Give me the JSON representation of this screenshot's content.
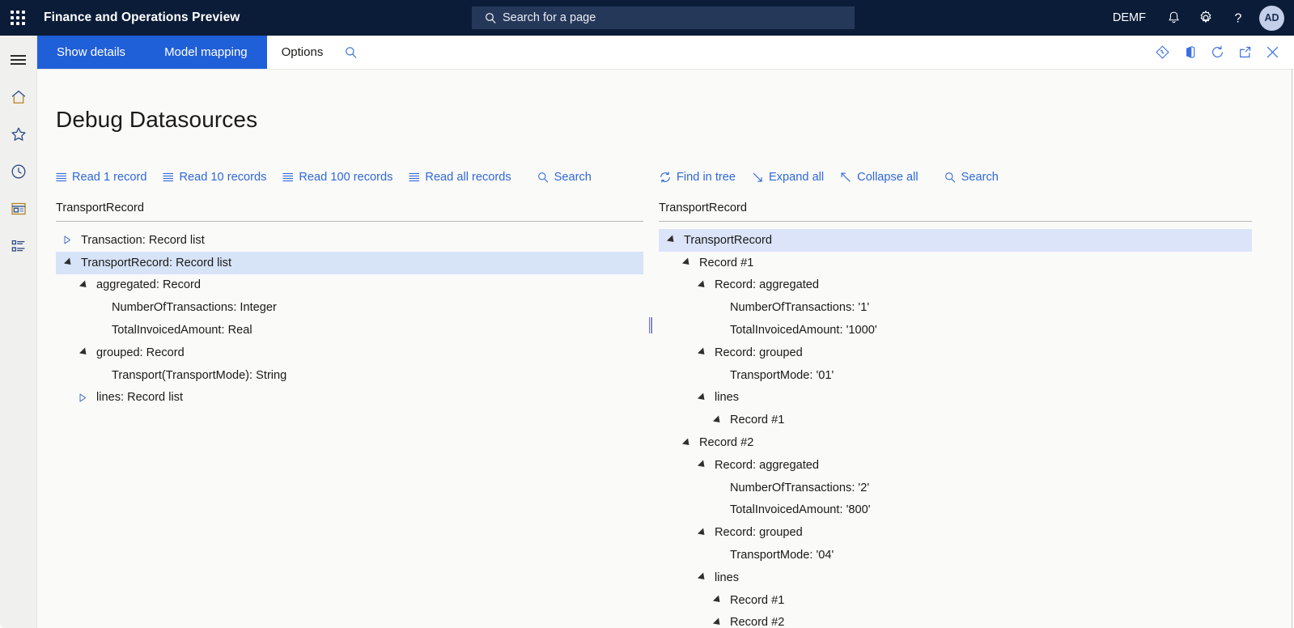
{
  "topbar": {
    "waffle_icon": "app-launcher-icon",
    "app_title": "Finance and Operations Preview",
    "search": {
      "placeholder": "Search for a page",
      "icon": "search-icon"
    },
    "company": "DEMF",
    "icons": [
      {
        "name": "notifications-icon",
        "glyph": "bell"
      },
      {
        "name": "settings-icon",
        "glyph": "gear"
      },
      {
        "name": "help-icon",
        "glyph": "question"
      }
    ],
    "avatar_initials": "AD",
    "colors": {
      "bar_bg": "#0b1c38",
      "search_bg": "#26385a",
      "avatar_bg": "#c3cfe8"
    }
  },
  "rail": {
    "items": [
      {
        "name": "hamburger-menu",
        "label": "Menu"
      },
      {
        "name": "home-icon",
        "label": "Home"
      },
      {
        "name": "favorites-star-icon",
        "label": "Favorites"
      },
      {
        "name": "recent-clock-icon",
        "label": "Recent"
      },
      {
        "name": "workspaces-icon",
        "label": "Workspaces"
      },
      {
        "name": "modules-list-icon",
        "label": "Modules"
      }
    ]
  },
  "action_pane": {
    "tabs": [
      {
        "label": "Show details",
        "active": true
      },
      {
        "label": "Model mapping",
        "active": true
      }
    ],
    "options_label": "Options",
    "search_icon": "search-icon",
    "accent_color": "#1f5fd8",
    "right_icons": [
      {
        "name": "attachments-icon"
      },
      {
        "name": "office-export-icon"
      },
      {
        "name": "refresh-icon"
      },
      {
        "name": "popout-icon"
      },
      {
        "name": "close-icon"
      }
    ]
  },
  "page": {
    "title": "Debug Datasources"
  },
  "left_panel": {
    "toolbar": [
      {
        "label": "Read 1 record",
        "icon": "list-icon"
      },
      {
        "label": "Read 10 records",
        "icon": "list-icon"
      },
      {
        "label": "Read 100 records",
        "icon": "list-icon"
      },
      {
        "label": "Read all records",
        "icon": "list-icon"
      },
      {
        "label": "Search",
        "icon": "search-icon"
      }
    ],
    "header": "TransportRecord",
    "tree": [
      {
        "label": "Transaction: Record list",
        "depth": 0,
        "state": "collapsed",
        "selected": false
      },
      {
        "label": "TransportRecord: Record list",
        "depth": 0,
        "state": "expanded",
        "selected": true
      },
      {
        "label": "aggregated: Record",
        "depth": 1,
        "state": "expanded",
        "selected": false
      },
      {
        "label": "NumberOfTransactions: Integer",
        "depth": 2,
        "state": "leaf",
        "selected": false
      },
      {
        "label": "TotalInvoicedAmount: Real",
        "depth": 2,
        "state": "leaf",
        "selected": false
      },
      {
        "label": "grouped: Record",
        "depth": 1,
        "state": "expanded",
        "selected": false
      },
      {
        "label": "Transport(TransportMode): String",
        "depth": 2,
        "state": "leaf",
        "selected": false
      },
      {
        "label": "lines: Record list",
        "depth": 1,
        "state": "collapsed",
        "selected": false
      }
    ]
  },
  "right_panel": {
    "toolbar": [
      {
        "label": "Find in tree",
        "icon": "refresh-icon"
      },
      {
        "label": "Expand all",
        "icon": "expand-arrow-icon"
      },
      {
        "label": "Collapse all",
        "icon": "collapse-arrow-icon"
      },
      {
        "label": "Search",
        "icon": "search-icon"
      }
    ],
    "header": "TransportRecord",
    "tree": [
      {
        "label": "TransportRecord",
        "depth": 0,
        "state": "expanded",
        "selected": true
      },
      {
        "label": "Record #1",
        "depth": 1,
        "state": "expanded",
        "selected": false
      },
      {
        "label": "Record: aggregated",
        "depth": 2,
        "state": "expanded",
        "selected": false
      },
      {
        "label": "NumberOfTransactions: '1'",
        "depth": 3,
        "state": "leaf",
        "selected": false
      },
      {
        "label": "TotalInvoicedAmount: '1000'",
        "depth": 3,
        "state": "leaf",
        "selected": false
      },
      {
        "label": "Record: grouped",
        "depth": 2,
        "state": "expanded",
        "selected": false
      },
      {
        "label": "TransportMode: '01'",
        "depth": 3,
        "state": "leaf",
        "selected": false
      },
      {
        "label": "lines",
        "depth": 2,
        "state": "expanded",
        "selected": false
      },
      {
        "label": "Record #1",
        "depth": 3,
        "state": "expanded",
        "selected": false
      },
      {
        "label": "Record #2",
        "depth": 1,
        "state": "expanded",
        "selected": false
      },
      {
        "label": "Record: aggregated",
        "depth": 2,
        "state": "expanded",
        "selected": false
      },
      {
        "label": "NumberOfTransactions: '2'",
        "depth": 3,
        "state": "leaf",
        "selected": false
      },
      {
        "label": "TotalInvoicedAmount: '800'",
        "depth": 3,
        "state": "leaf",
        "selected": false
      },
      {
        "label": "Record: grouped",
        "depth": 2,
        "state": "expanded",
        "selected": false
      },
      {
        "label": "TransportMode: '04'",
        "depth": 3,
        "state": "leaf",
        "selected": false
      },
      {
        "label": "lines",
        "depth": 2,
        "state": "expanded",
        "selected": false
      },
      {
        "label": "Record #1",
        "depth": 3,
        "state": "expanded",
        "selected": false
      },
      {
        "label": "Record #2",
        "depth": 3,
        "state": "expanded",
        "selected": false
      }
    ]
  },
  "splitter": {
    "name": "pane-splitter"
  }
}
